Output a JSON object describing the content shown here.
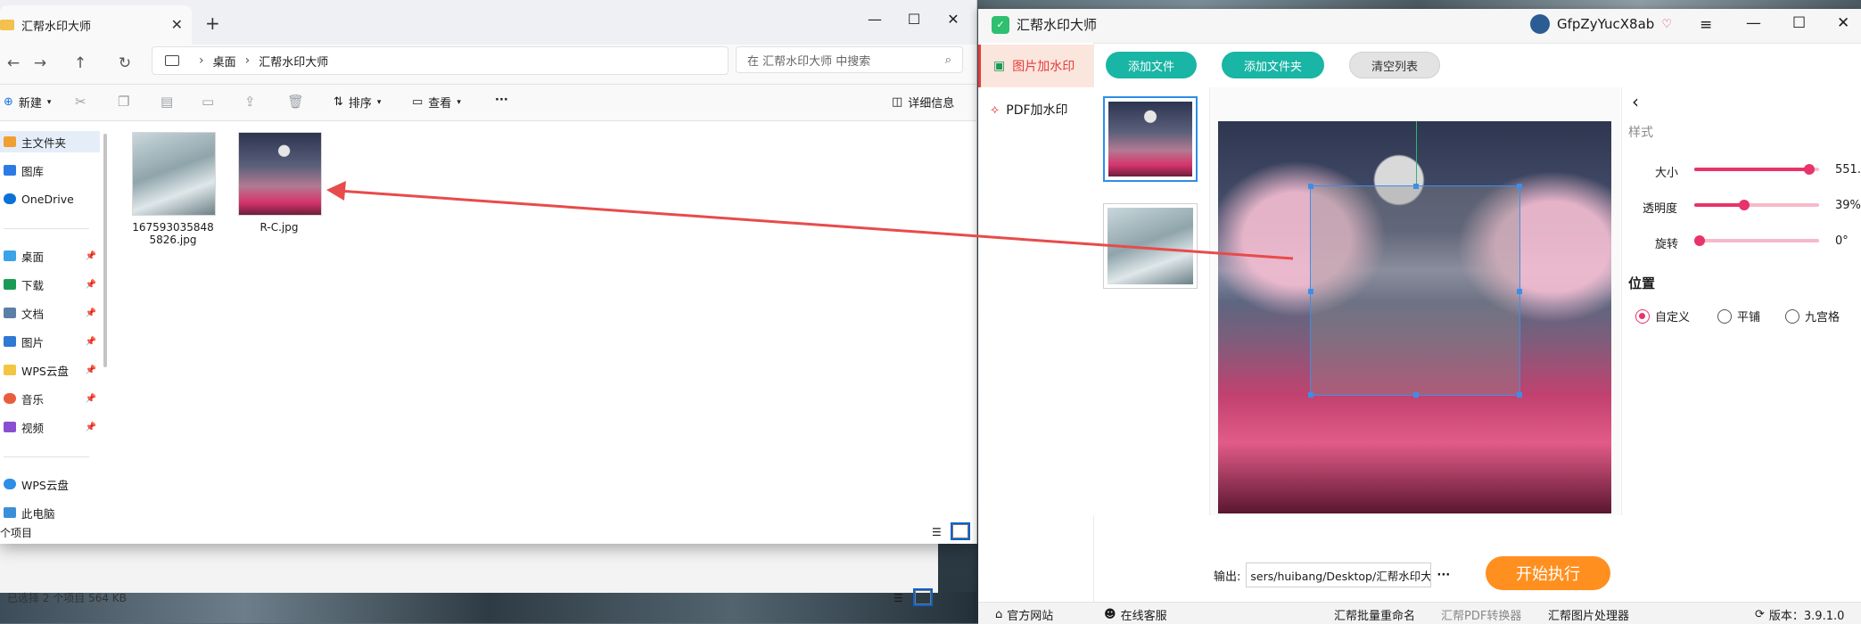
{
  "explorer": {
    "tab_title": "汇帮水印大师",
    "breadcrumb": [
      "桌面",
      "汇帮水印大师"
    ],
    "search_placeholder": "在 汇帮水印大师 中搜索",
    "toolbar": {
      "new_label": "新建",
      "sort_label": "排序",
      "view_label": "查看",
      "more_label": "···",
      "details_label": "详细信息"
    },
    "sidebar": [
      {
        "label": "主文件夹",
        "color": "#f0a032"
      },
      {
        "label": "图库",
        "color": "#2c7be5"
      },
      {
        "label": "OneDrive",
        "color": "#0a72d6"
      },
      {
        "label": "桌面",
        "color": "#3ba3e8"
      },
      {
        "label": "下载",
        "color": "#1a9b55"
      },
      {
        "label": "文档",
        "color": "#5b7fa6"
      },
      {
        "label": "图片",
        "color": "#2f78d4"
      },
      {
        "label": "WPS云盘",
        "color": "#f4c542"
      },
      {
        "label": "音乐",
        "color": "#e85d3b"
      },
      {
        "label": "视频",
        "color": "#8a4fd1"
      },
      {
        "label": "WPS云盘",
        "color": "#2d8ee6"
      },
      {
        "label": "此电脑",
        "color": "#3a8fd8"
      }
    ],
    "files": [
      {
        "name": "1675930358485826.jpg"
      },
      {
        "name": "R-C.jpg"
      }
    ],
    "status_items": "个项目",
    "status_selected": "已选择 2 个项目  564 KB"
  },
  "app": {
    "title": "汇帮水印大师",
    "username": "GfpZyYucX8ab",
    "nav": [
      {
        "label": "图片加水印"
      },
      {
        "label": "PDF加水印"
      }
    ],
    "buttons": {
      "add_file": "添加文件",
      "add_folder": "添加文件夹",
      "clear_list": "清空列表",
      "start": "开始执行"
    },
    "style_heading": "样式",
    "sliders": [
      {
        "label": "大小",
        "value_text": "551.",
        "level": 0.96
      },
      {
        "label": "透明度",
        "value_text": "39%",
        "level": 0.39
      },
      {
        "label": "旋转",
        "value_text": "0°",
        "level": 0.0
      }
    ],
    "position_heading": "位置",
    "position_options": [
      {
        "label": "自定义",
        "selected": true
      },
      {
        "label": "平铺",
        "selected": false
      },
      {
        "label": "九宫格",
        "selected": false
      }
    ],
    "output_label": "输出:",
    "output_path": "sers/huibang/Desktop/汇帮水印大师",
    "output_more": "···",
    "footer": {
      "website": "官方网站",
      "service": "在线客服",
      "rename": "汇帮批量重命名",
      "pdf": "汇帮PDF转换器",
      "image": "汇帮图片处理器",
      "version": "版本：3.9.1.0"
    }
  },
  "colors": {
    "accent_teal": "#19b5a5",
    "accent_pink": "#e8336b",
    "accent_orange": "#ff8f1f",
    "arrow_red": "#e84b4b"
  }
}
